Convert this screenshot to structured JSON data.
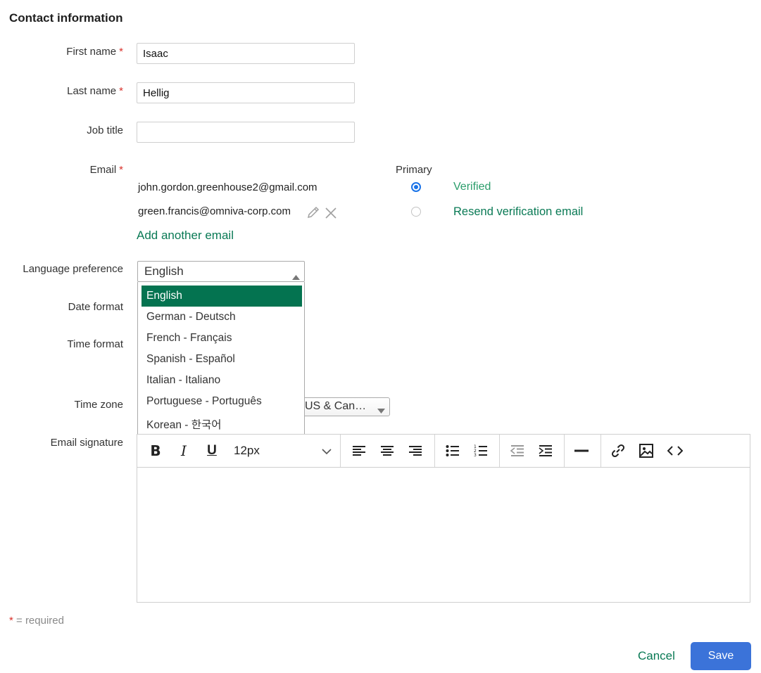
{
  "section_title": "Contact information",
  "fields": {
    "first_name": {
      "label": "First name",
      "required": "*",
      "value": "Isaac"
    },
    "last_name": {
      "label": "Last name",
      "required": "*",
      "value": "Hellig"
    },
    "job_title": {
      "label": "Job title",
      "value": ""
    },
    "email": {
      "label": "Email",
      "required": "*"
    }
  },
  "emails": {
    "primary_header": "Primary",
    "items": [
      {
        "address": "john.gordon.greenhouse2@gmail.com",
        "primary": true,
        "status": "Verified"
      },
      {
        "address": "green.francis@omniva-corp.com",
        "primary": false,
        "status": "Resend verification email"
      }
    ],
    "add_another": "Add another email"
  },
  "language": {
    "label": "Language preference",
    "selected": "English",
    "options": [
      "English",
      "German - Deutsch",
      "French - Français",
      "Spanish - Español",
      "Italian - Italiano",
      "Portuguese - Português",
      "Korean - 한국어"
    ]
  },
  "date_format": {
    "label": "Date format"
  },
  "time_format": {
    "label": "Time format"
  },
  "time_zone": {
    "label": "Time zone",
    "value": "US & Can…"
  },
  "signature": {
    "label": "Email signature",
    "font_size": "12px"
  },
  "footer": {
    "required_note_star": "*",
    "required_note": " = required",
    "cancel": "Cancel",
    "save": "Save"
  },
  "colors": {
    "accent_green": "#047350",
    "link_green": "#0a7a55",
    "primary_blue": "#3b73d9",
    "required_red": "#d9312b"
  }
}
